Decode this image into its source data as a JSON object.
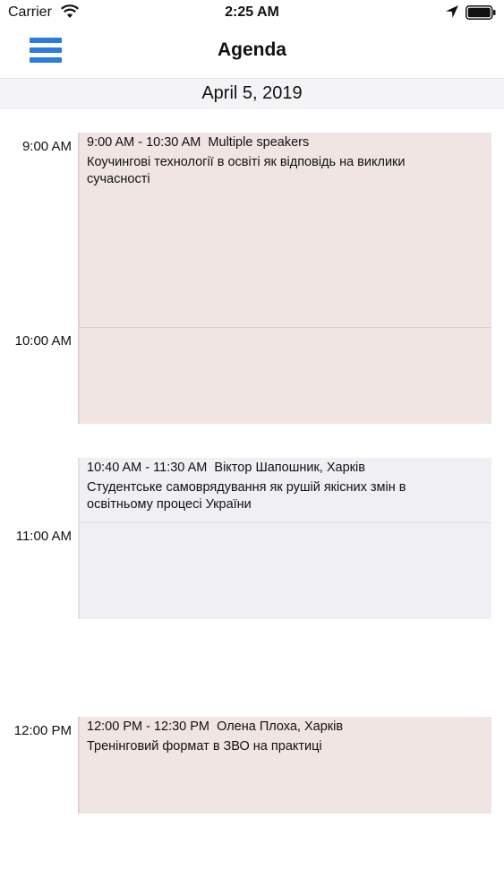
{
  "status_bar": {
    "carrier": "Carrier",
    "time": "2:25 AM",
    "icons": [
      "wifi-icon",
      "location-icon",
      "battery-icon"
    ]
  },
  "nav": {
    "title": "Agenda",
    "menu_icon": "hamburger-menu-icon",
    "accent_color": "#2a7be4"
  },
  "date": "April 5, 2019",
  "hours": [
    "9:00 AM",
    "10:00 AM",
    "11:00 AM",
    "12:00 PM"
  ],
  "events": [
    {
      "time": "9:00 AM - 10:30 AM",
      "speaker": "Multiple speakers",
      "title": "Коучингові технології в освіті як відповідь на виклики сучасності",
      "color": "#f1e5e3"
    },
    {
      "time": "10:40 AM - 11:30 AM",
      "speaker": "Віктор Шапошник, Харків",
      "title": "Студентське самоврядування як рушій якісних змін в освітньому процесі України",
      "color": "#f0f0f4"
    },
    {
      "time": "12:00 PM - 12:30 PM",
      "speaker": "Олена Плоха, Харків",
      "title": "Тренінговий формат в ЗВО на практиці",
      "color": "#f1e5e3"
    }
  ]
}
